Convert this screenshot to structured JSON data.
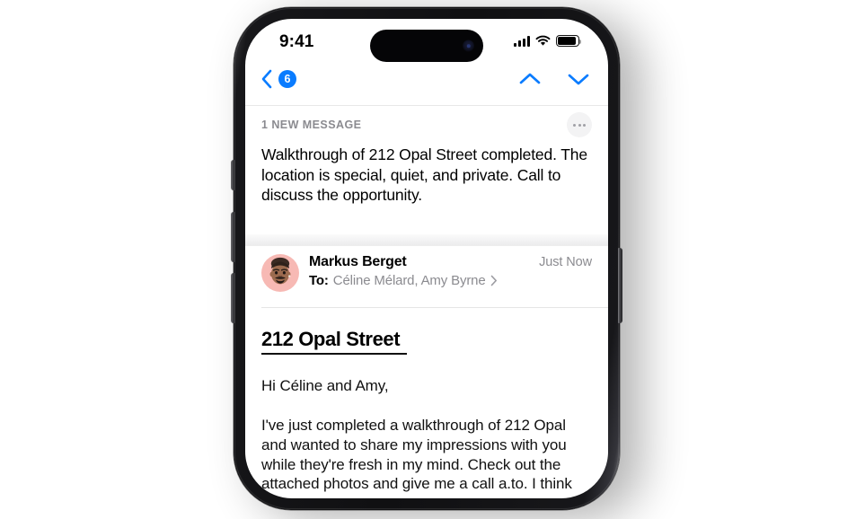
{
  "status_bar": {
    "time": "9:41",
    "signal_icon": "cellular-signal-icon",
    "wifi_icon": "wifi-icon",
    "battery_icon": "battery-icon"
  },
  "nav_bar": {
    "back_icon": "chevron-left-icon",
    "unread_badge": "6",
    "prev_icon": "chevron-up-icon",
    "next_icon": "chevron-down-icon"
  },
  "summary": {
    "label": "1 NEW MESSAGE",
    "more_icon": "ellipsis-icon",
    "text": "Walkthrough of 212 Opal Street completed. The location is special, quiet, and private. Call to discuss the opportunity."
  },
  "sender": {
    "avatar_icon": "memoji-avatar",
    "avatar_bg": "#f7b9b4",
    "name": "Markus Berget",
    "timestamp": "Just Now",
    "to_label": "To:",
    "recipients": "Céline Mélard, Amy Byrne",
    "disclosure_icon": "chevron-right-icon"
  },
  "message": {
    "subject": "212 Opal Street",
    "greeting": "Hi Céline and Amy,",
    "body": "I've just completed a walkthrough of 212 Opal and wanted to share my impressions with you while they're fresh in my mind. Check out the attached photos and give me a call a.to. I think this property presents an"
  },
  "device": {
    "action_button": "action-button",
    "volume_up_button": "volume-up-button",
    "volume_down_button": "volume-down-button",
    "power_button": "power-button",
    "dynamic_island": "dynamic-island",
    "camera": "front-camera"
  },
  "colors": {
    "accent_blue": "#0a7cff",
    "secondary_text": "#8b8b90"
  }
}
